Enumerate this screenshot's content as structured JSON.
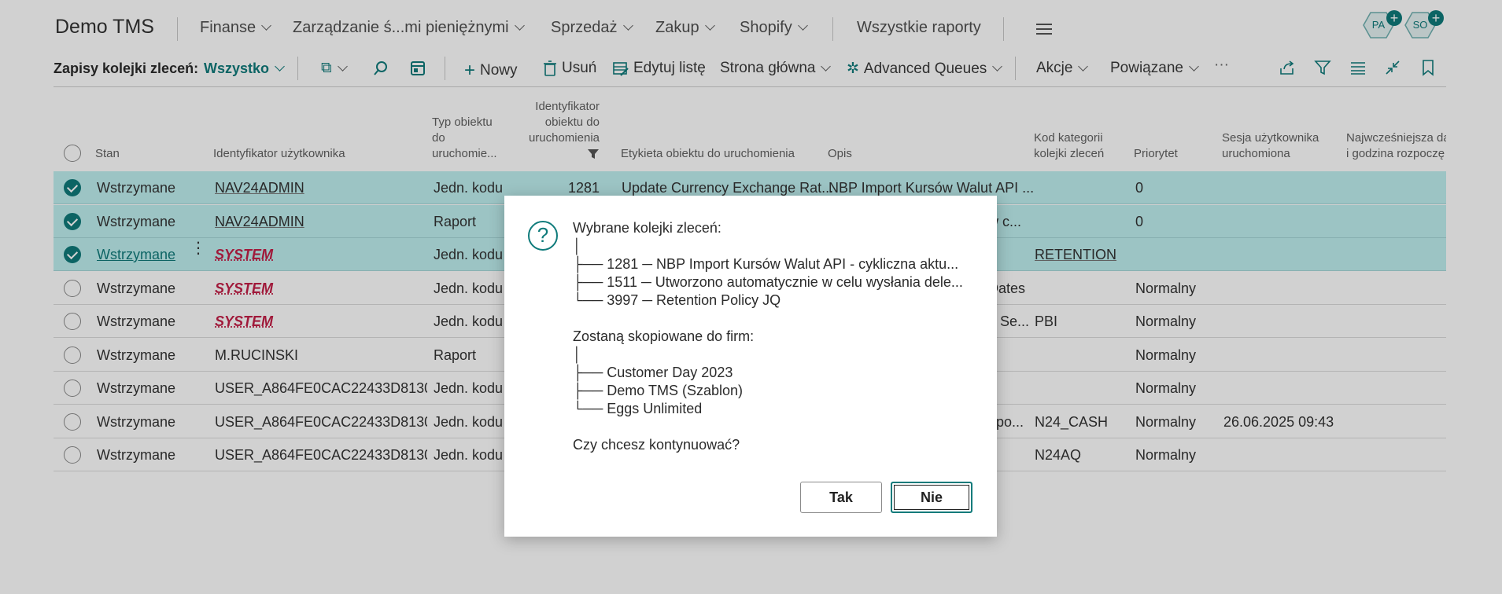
{
  "nav": {
    "brand": "Demo TMS",
    "items": [
      "Finanse",
      "Zarządzanie ś...mi pieniężnymi",
      "Sprzedaż",
      "Zakup",
      "Shopify"
    ],
    "all_reports": "Wszystkie raporty",
    "avatars": [
      "PA",
      "SO"
    ]
  },
  "actionbar": {
    "title": "Zapisy kolejki zleceń:",
    "filter": "Wszystko",
    "new": "Nowy",
    "delete": "Usuń",
    "edit_list": "Edytuj listę",
    "home": "Strona główna",
    "advanced": "Advanced Queues",
    "actions": "Akcje",
    "related": "Powiązane",
    "more": "···"
  },
  "columns": {
    "status": "Stan",
    "user_id": "Identyfikator użytkownika",
    "obj_type": [
      "Typ obiektu",
      "do",
      "uruchomie..."
    ],
    "obj_id": [
      "Identyfikator",
      "obiektu do",
      "uruchomienia"
    ],
    "obj_caption": "Etykieta obiektu do uruchomienia",
    "description": "Opis",
    "category": [
      "Kod kategorii",
      "kolejki zleceń"
    ],
    "priority": "Priorytet",
    "session": [
      "Sesja użytkownika",
      "uruchomiona"
    ],
    "earliest": [
      "Najwcześniejsza da",
      "i godzina rozpoczę"
    ]
  },
  "rows": [
    {
      "selected": true,
      "status": "Wstrzymane",
      "user": "NAV24ADMIN",
      "type": "Jedn. kodu",
      "id": "1281",
      "caption": "Update Currency Exchange Rat...",
      "desc": "NBP Import Kursów Walut API ...",
      "category": "",
      "priority": "0",
      "session": ""
    },
    {
      "selected": true,
      "status": "Wstrzymane",
      "user": "NAV24ADMIN",
      "type": "Raport",
      "id": "",
      "caption": "",
      "desc": "w c...",
      "category": "",
      "priority": "0",
      "session": ""
    },
    {
      "selected": true,
      "status": "Wstrzymane",
      "user": "SYSTEM",
      "type": "Jedn. kodu",
      "id": "",
      "caption": "",
      "desc": "",
      "category": "RETENTION",
      "priority": "",
      "session": ""
    },
    {
      "selected": false,
      "status": "Wstrzymane",
      "user": "SYSTEM",
      "type": "Jedn. kodu",
      "id": "",
      "caption": "",
      "desc": "Dates",
      "category": "",
      "priority": "Normalny",
      "session": ""
    },
    {
      "selected": false,
      "status": "Wstrzymane",
      "user": "SYSTEM",
      "type": "Jedn. kodu",
      "id": "",
      "caption": "",
      "desc": "n Se...",
      "category": "PBI",
      "priority": "Normalny",
      "session": ""
    },
    {
      "selected": false,
      "status": "Wstrzymane",
      "user": "M.RUCINSKI",
      "type": "Raport",
      "id": "",
      "caption": "",
      "desc": "",
      "category": "",
      "priority": "Normalny",
      "session": ""
    },
    {
      "selected": false,
      "status": "Wstrzymane",
      "user": "USER_A864FE0CAC22433D8130B...",
      "type": "Jedn. kodu",
      "id": "",
      "caption": "",
      "desc": "",
      "category": "",
      "priority": "Normalny",
      "session": ""
    },
    {
      "selected": false,
      "status": "Wstrzymane",
      "user": "USER_A864FE0CAC22433D8130B...",
      "type": "Jedn. kodu",
      "id": "",
      "caption": "",
      "desc": "apo...",
      "category": "N24_CASH",
      "priority": "Normalny",
      "session": "26.06.2025 09:43"
    },
    {
      "selected": false,
      "status": "Wstrzymane",
      "user": "USER_A864FE0CAC22433D8130B...",
      "type": "Jedn. kodu",
      "id": "",
      "caption": "",
      "desc": "",
      "category": "N24AQ",
      "priority": "Normalny",
      "session": ""
    }
  ],
  "dialog": {
    "lines": [
      "Wybrane kolejki zleceń:",
      "│",
      "├── 1281 ─ NBP Import Kursów Walut API - cykliczna aktu...",
      "├── 1511 ─ Utworzono automatycznie w celu wysłania dele...",
      "└── 3997 ─ Retention Policy JQ",
      "",
      "Zostaną skopiowane do firm:",
      "│",
      "├── Customer Day 2023",
      "├── Demo TMS (Szablon)",
      "└── Eggs Unlimited",
      "",
      "Czy chcesz kontynuować?"
    ],
    "yes": "Tak",
    "no": "Nie"
  }
}
